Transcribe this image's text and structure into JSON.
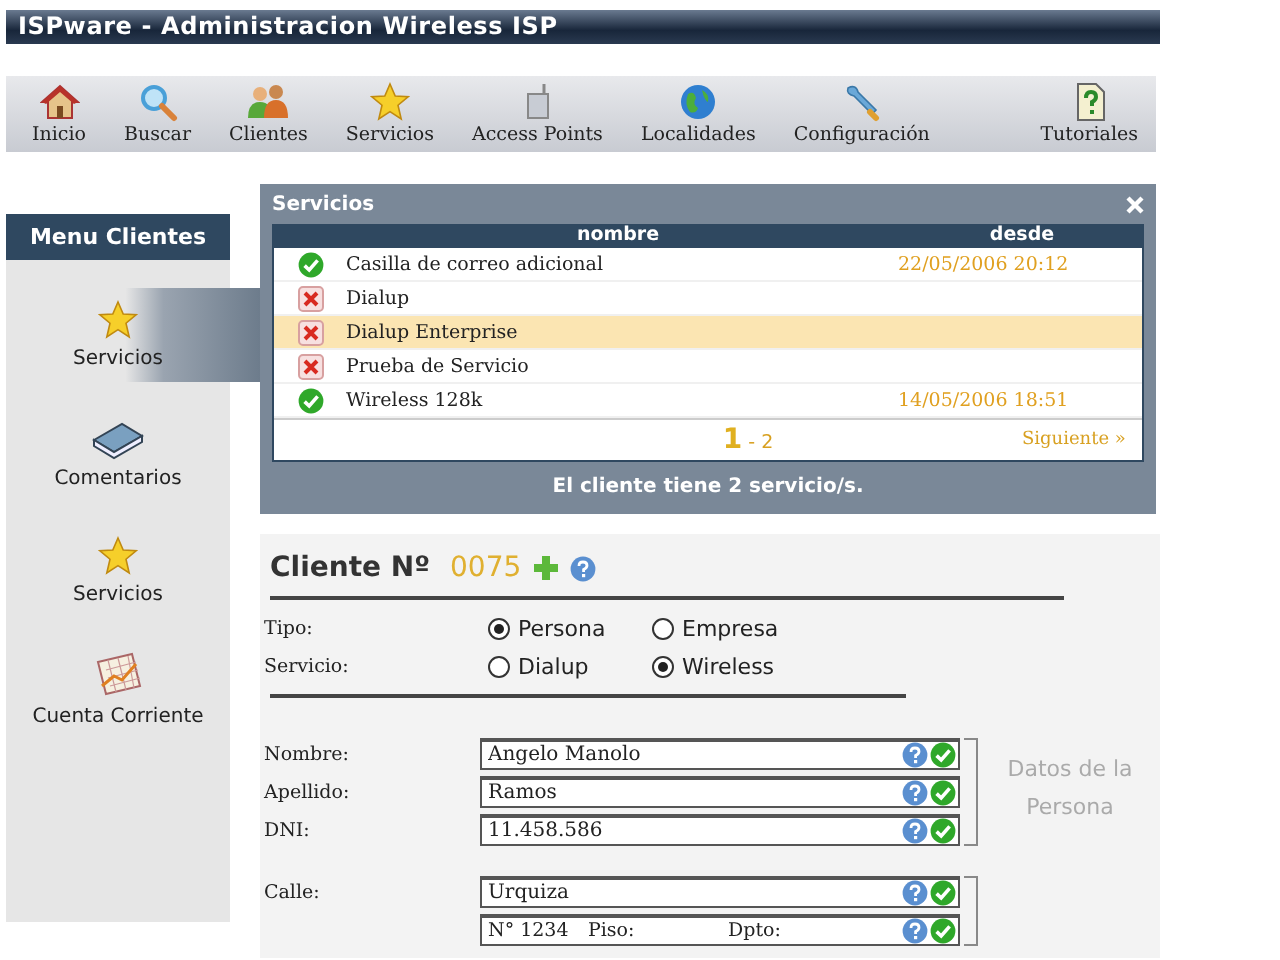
{
  "window": {
    "title": "ISPware - Administracion Wireless ISP"
  },
  "toolbar": [
    {
      "label": "Inicio",
      "kind": "house"
    },
    {
      "label": "Buscar",
      "kind": "search"
    },
    {
      "label": "Clientes",
      "kind": "people"
    },
    {
      "label": "Servicios",
      "kind": "star"
    },
    {
      "label": "Access Points",
      "kind": "device"
    },
    {
      "label": "Localidades",
      "kind": "globe"
    },
    {
      "label": "Configuración",
      "kind": "wrench"
    },
    {
      "label": "Tutoriales",
      "kind": "help"
    }
  ],
  "menu": {
    "title": "Menu Clientes",
    "items": [
      {
        "label": "Servicios",
        "kind": "star",
        "selected": true
      },
      {
        "label": "Comentarios",
        "kind": "book",
        "selected": false
      },
      {
        "label": "Servicios",
        "kind": "star",
        "selected": false
      },
      {
        "label": "Cuenta Corriente",
        "kind": "chart",
        "selected": false
      }
    ]
  },
  "services_panel": {
    "title": "Servicios",
    "columns": [
      "nombre",
      "desde"
    ],
    "rows": [
      {
        "name": "Casilla de correo adicional",
        "since": "22/05/2006 20:12",
        "active": true,
        "selected": false
      },
      {
        "name": "Dialup",
        "active": false,
        "selected": false
      },
      {
        "name": "Dialup Enterprise",
        "active": false,
        "selected": true
      },
      {
        "name": "Prueba de Servicio",
        "active": false,
        "selected": false
      },
      {
        "name": "Wireless 128k",
        "since": "14/05/2006 18:51",
        "active": true,
        "selected": false
      }
    ],
    "pages": [
      {
        "label": "1",
        "selected": true
      },
      {
        "label": "2",
        "selected": false
      }
    ],
    "page_separator": "-",
    "next": "Siguiente »",
    "footer": "El cliente tiene 2 servicio/s."
  },
  "client_form": {
    "heading": "Cliente Nº",
    "number": "0075",
    "radio_groups": [
      {
        "label": "Tipo:",
        "options": [
          {
            "label": "Persona",
            "selected": true
          },
          {
            "label": "Empresa",
            "selected": false
          }
        ]
      },
      {
        "label": "Servicio:",
        "options": [
          {
            "label": "Dialup",
            "selected": false
          },
          {
            "label": "Wireless",
            "selected": true
          }
        ]
      }
    ],
    "field_groups": [
      {
        "caption": "Datos de la Persona",
        "fields": [
          {
            "label": "Nombre:",
            "value": "Angelo Manolo",
            "valid": true
          },
          {
            "label": "Apellido:",
            "value": "Ramos",
            "valid": true
          },
          {
            "label": "DNI:",
            "value": "11.458.586",
            "valid": true
          }
        ]
      },
      {
        "fields": [
          {
            "label": "Calle:",
            "value": "Urquiza",
            "valid": true
          },
          {
            "segments": [
              "N° 1234",
              "Piso:",
              "Dpto:"
            ],
            "valid": true
          }
        ]
      }
    ]
  }
}
